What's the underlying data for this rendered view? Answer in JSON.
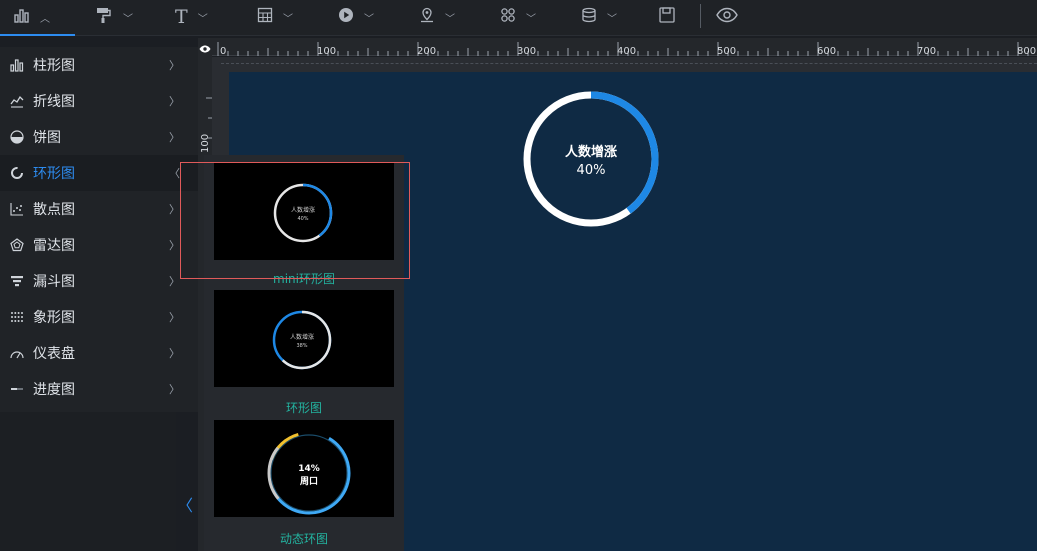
{
  "toolbar": {
    "items": [
      {
        "icon": "bar-chart-icon"
      },
      {
        "icon": "paint-roller-icon"
      },
      {
        "icon": "text-icon",
        "glyph": "T"
      },
      {
        "icon": "table-icon"
      },
      {
        "icon": "media-play-icon"
      },
      {
        "icon": "map-pin-icon"
      },
      {
        "icon": "widgets-icon"
      },
      {
        "icon": "database-icon"
      },
      {
        "icon": "save-icon"
      },
      {
        "icon": "eye-icon"
      }
    ]
  },
  "sidebar": {
    "items": [
      {
        "label": "柱形图",
        "icon": "bar-chart-icon"
      },
      {
        "label": "折线图",
        "icon": "line-chart-icon"
      },
      {
        "label": "饼图",
        "icon": "pie-chart-icon"
      },
      {
        "label": "环形图",
        "icon": "ring-chart-icon",
        "active": true
      },
      {
        "label": "散点图",
        "icon": "scatter-chart-icon"
      },
      {
        "label": "雷达图",
        "icon": "radar-chart-icon"
      },
      {
        "label": "漏斗图",
        "icon": "funnel-chart-icon"
      },
      {
        "label": "象形图",
        "icon": "pictorial-chart-icon"
      },
      {
        "label": "仪表盘",
        "icon": "gauge-icon"
      },
      {
        "label": "进度图",
        "icon": "progress-icon"
      }
    ]
  },
  "ruler": {
    "top_ticks": [
      "0",
      "100",
      "200",
      "300",
      "400",
      "500",
      "600",
      "700",
      "800"
    ],
    "left_tick": "100"
  },
  "canvas_widget": {
    "title": "人数增涨",
    "value": "40%",
    "percent": 40,
    "track_color": "#ffffff",
    "fill_color": "#1e88e5"
  },
  "flyout": {
    "cards": [
      {
        "label": "mini环形图",
        "title": "人数增涨",
        "value": "40%",
        "percent": 40
      },
      {
        "label": "环形图",
        "title": "人数增涨",
        "value": "38%",
        "percent": 38
      },
      {
        "label": "动态环图",
        "title": "周口",
        "value": "14%",
        "percent": 14
      }
    ]
  },
  "colors": {
    "accent": "#2d8cf0",
    "card_label": "#23b3a0",
    "highlight_border": "#e05a5a",
    "canvas_bg": "#0f2a44"
  }
}
